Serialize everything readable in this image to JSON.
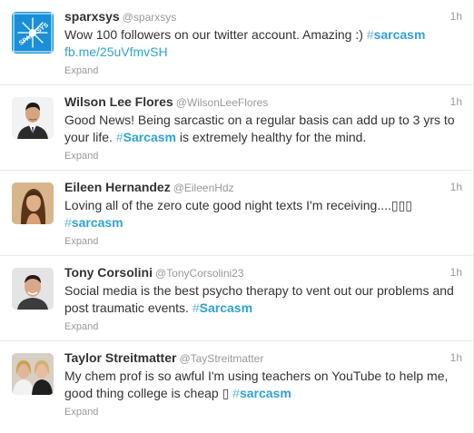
{
  "tweets": [
    {
      "fullname": "sparxsys",
      "username": "@sparxsys",
      "time": "1h",
      "text_before": "Wow 100 followers on our twitter account. Amazing :) ",
      "hashtag_word": "sarcasm",
      "line2_link": "fb.me/25uVfmvSH",
      "text_after": "",
      "expand": "Expand",
      "avatar_text": "SPARXSYS",
      "avatar_color": "#1a8fd8"
    },
    {
      "fullname": "Wilson Lee Flores",
      "username": "@WilsonLeeFlores",
      "time": "1h",
      "text_before": "Good News! Being sarcastic on a regular basis can add up to 3 yrs to your life. ",
      "hashtag_word": "Sarcasm",
      "text_after": " is extremely healthy for the mind.",
      "expand": "Expand"
    },
    {
      "fullname": "Eileen Hernandez",
      "username": "@EileenHdz",
      "time": "1h",
      "text_before": "Loving all of the zero cute good night texts I'm receiving....▯▯▯ ",
      "hashtag_word": "sarcasm",
      "text_after": "",
      "expand": "Expand"
    },
    {
      "fullname": "Tony Corsolini",
      "username": "@TonyCorsolini23",
      "time": "1h",
      "text_before": "Social media is the best psycho therapy to vent out our problems and post traumatic events. ",
      "hashtag_word": "Sarcasm",
      "text_after": "",
      "expand": "Expand"
    },
    {
      "fullname": "Taylor Streitmatter",
      "username": "@TayStreitmatter",
      "time": "1h",
      "text_before": "My chem prof is so awful I'm using teachers on YouTube to help me, good thing college is cheap ▯ ",
      "hashtag_word": "sarcasm",
      "text_after": "",
      "expand": "Expand"
    }
  ],
  "hash_symbol": "#",
  "colors": {
    "hashtag": "#2fa2d3",
    "muted": "#999999",
    "name": "#333333"
  }
}
